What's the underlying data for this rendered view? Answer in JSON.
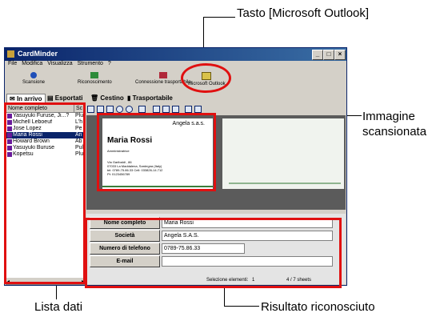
{
  "callouts": {
    "outlook": "Tasto [Microsoft Outlook]",
    "image": "Immagine scansionata",
    "image_l1": "Immagine",
    "image_l2": "scansionata",
    "list": "Lista dati",
    "result": "Risultato riconosciuto"
  },
  "window": {
    "title": "CardMinder",
    "menu": [
      "File",
      "Modifica",
      "Visualizza",
      "Strumento",
      "?"
    ],
    "toolbar": [
      "Scansione",
      "Riconoscimento",
      "Connessione trasportabile",
      "Microsoft Outlook"
    ],
    "tabs": [
      "In arrivo",
      "Esportati",
      "Cestino",
      "Trasportabile"
    ],
    "list": {
      "headers": [
        "Nome completo",
        "Sc"
      ],
      "rows": [
        {
          "name": "Yasuyuki Furuse, Ji...?",
          "short": "Plu"
        },
        {
          "name": "Michell Leboeuf",
          "short": "L'h"
        },
        {
          "name": "Jose Lopez",
          "short": "Pe"
        },
        {
          "name": "Maria Rossi",
          "short": "An"
        },
        {
          "name": "Howard Brown",
          "short": "Ab"
        },
        {
          "name": "Yasuyuki Buruse",
          "short": "Pul"
        },
        {
          "name": "Kopetsu",
          "short": "Plu"
        }
      ],
      "selected_index": 3
    },
    "card": {
      "company": "Angela s.a.s.",
      "name": "Maria Rossi",
      "role": "Amministratrice",
      "addr1": "Via Garibaldi , 86",
      "addr2": "07033 La Maddalena, Sardegna (Italy)",
      "phone": "tel: 0789-75.86.33    Cell: 033826-14.712",
      "fax": "Pt: 0123456789"
    },
    "form": {
      "fields": [
        {
          "label": "Nome completo",
          "value": "Maria Rossi"
        },
        {
          "label": "Società",
          "value": "Angela S.A.S."
        },
        {
          "label": "Numero di telefono",
          "value": "0789-75.86.33"
        },
        {
          "label": "E-mail",
          "value": ""
        }
      ]
    },
    "status": {
      "selection": "Selezione elementi:",
      "count": "1",
      "pages": "4 /    7 sheets"
    }
  },
  "colors": {
    "highlight": "#e01010",
    "title_bar": "#0a246a"
  }
}
